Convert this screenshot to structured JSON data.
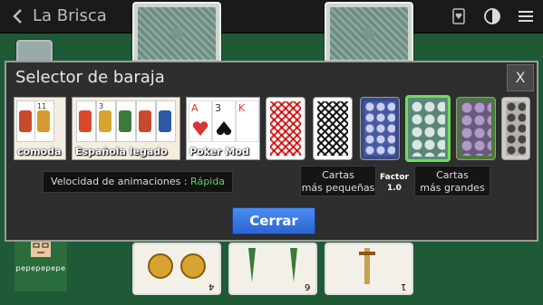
{
  "header": {
    "title": "La Brisca",
    "icons": [
      "back-icon",
      "card-suit-icon",
      "contrast-icon",
      "menu-icon"
    ]
  },
  "player": {
    "name": "pepepepepe"
  },
  "dialog": {
    "title": "Selector de baraja",
    "close_label": "X",
    "decks": [
      {
        "label": "comoda",
        "numbers": [
          "11"
        ]
      },
      {
        "label": "Española legado",
        "numbers": [
          "3"
        ]
      },
      {
        "label": "Poker Mod",
        "numbers": [
          "A",
          "3",
          "K"
        ]
      }
    ],
    "back_patterns": [
      "red-lattice",
      "black-lattice",
      "blue-floral",
      "green-floral",
      "purple-floral",
      "gray-floral"
    ],
    "selected_back": "green-floral",
    "speed": {
      "label": "Velocidad de animaciones : ",
      "value": "Rápida"
    },
    "smaller_button": {
      "line1": "Cartas",
      "line2": "más pequeñas"
    },
    "factor": {
      "label": "Factor",
      "value": "1.0"
    },
    "larger_button": {
      "line1": "Cartas",
      "line2": "más grandes"
    },
    "close_button": "Cerrar"
  },
  "table": {
    "bottom_cards": [
      "4",
      "6",
      "1"
    ]
  },
  "colors": {
    "felt": "#1f5a37",
    "dialog_bg": "#2e2e2e",
    "accent_green": "#5fd05f",
    "selected_border": "#6cdf5a",
    "button_blue": "#2b64d4"
  }
}
